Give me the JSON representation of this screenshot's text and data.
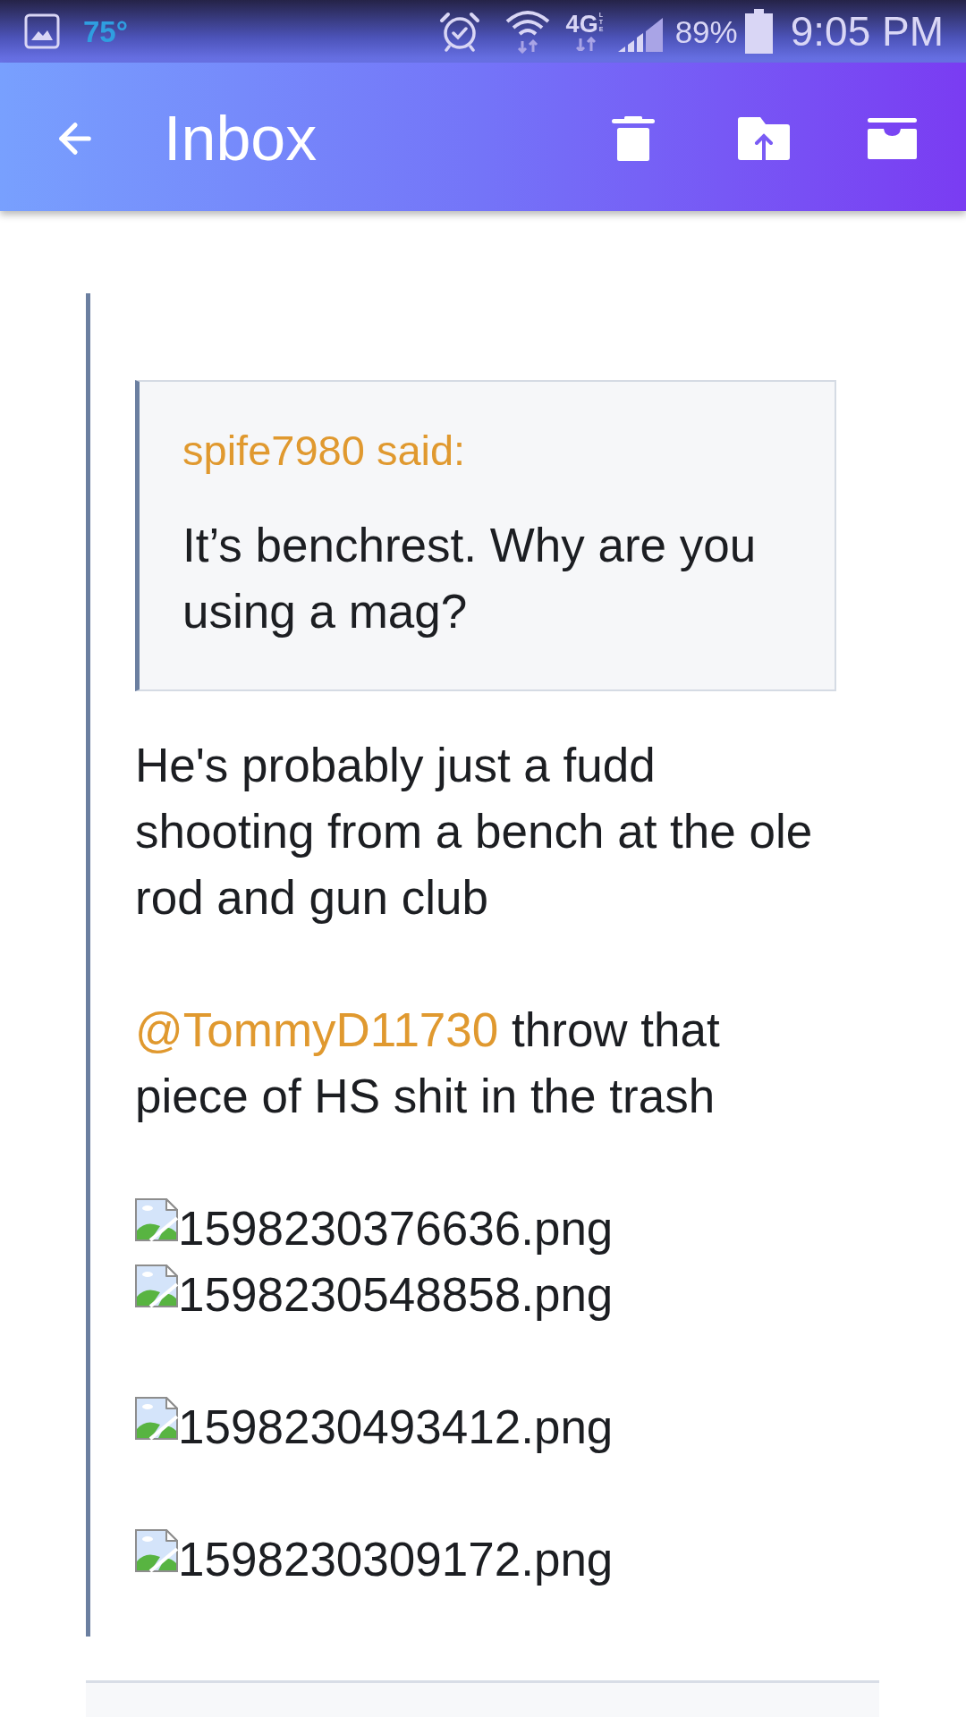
{
  "status_bar": {
    "temperature": "75°",
    "network": "4G",
    "network_sub": "LTE",
    "battery": "89%",
    "time": "9:05 PM"
  },
  "app_bar": {
    "title": "Inbox"
  },
  "post": {
    "quote": {
      "author": "spife7980 said:",
      "text": "It’s benchrest. Why are you using a mag?"
    },
    "paragraphs": [
      {
        "segments": [
          {
            "kind": "text",
            "text": "He's probably just a fudd shooting from a bench at the ole rod and gun club"
          }
        ]
      },
      {
        "segments": [
          {
            "kind": "mention",
            "text": "@TommyD11730"
          },
          {
            "kind": "text",
            "text": " throw that piece of HS shit in the trash"
          }
        ]
      }
    ],
    "attachment_groups": [
      [
        "1598230376636.png",
        "1598230548858.png"
      ],
      [
        "1598230493412.png"
      ],
      [
        "1598230309172.png"
      ]
    ]
  }
}
